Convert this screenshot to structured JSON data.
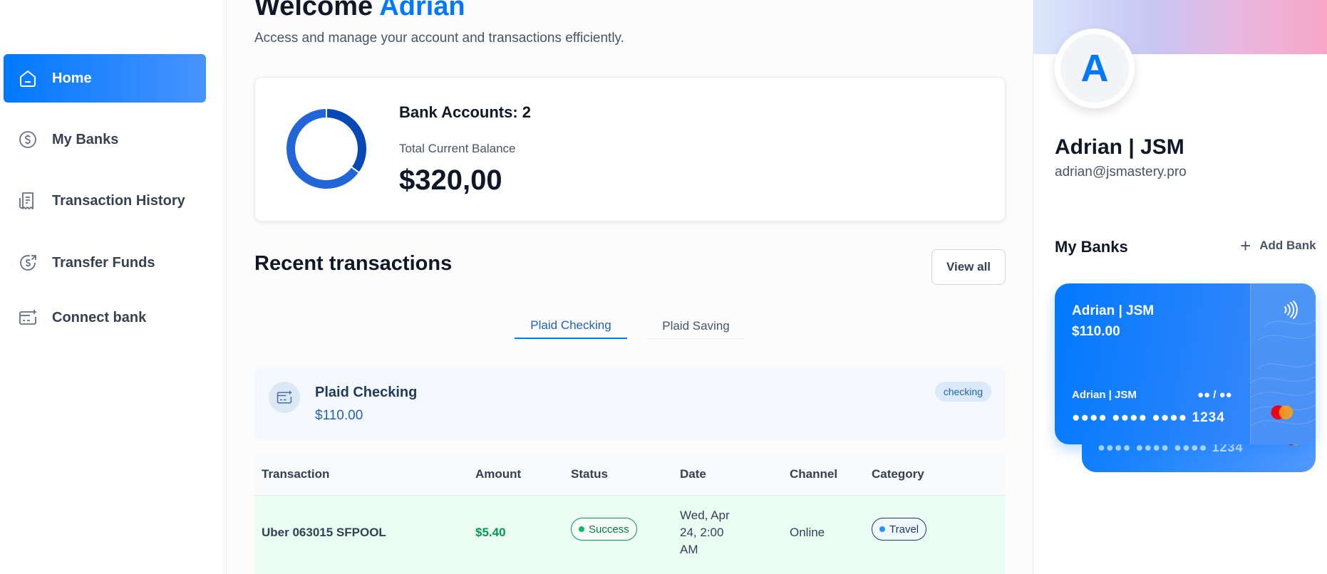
{
  "sidebar": {
    "items": [
      {
        "label": "Home",
        "icon": "home-icon",
        "active": true
      },
      {
        "label": "My Banks",
        "icon": "dollar-circle-icon",
        "active": false
      },
      {
        "label": "Transaction History",
        "icon": "receipt-icon",
        "active": false
      },
      {
        "label": "Transfer Funds",
        "icon": "money-send-icon",
        "active": false
      },
      {
        "label": "Connect bank",
        "icon": "card-add-icon",
        "active": false
      }
    ]
  },
  "header": {
    "welcome_prefix": "Welcome",
    "user_name": "Adrian",
    "subtitle": "Access and manage your account and transactions efficiently."
  },
  "balance": {
    "bank_accounts_label": "Bank Accounts: 2",
    "total_label": "Total Current Balance",
    "total_value": "$320,00",
    "donut_shares": [
      0.35,
      0.65
    ],
    "colors": [
      "#0747b6",
      "#2265d8"
    ]
  },
  "recent": {
    "title": "Recent transactions",
    "view_all": "View all",
    "tabs": [
      "Plaid Checking",
      "Plaid Saving"
    ],
    "active_tab": 0,
    "bank_info": {
      "name": "Plaid Checking",
      "amount": "$110.00",
      "type": "checking"
    },
    "columns": [
      "Transaction",
      "Amount",
      "Status",
      "Date",
      "Channel",
      "Category"
    ],
    "rows": [
      {
        "name": "Uber 063015 SFPOOL",
        "amount": "$5.40",
        "status": "Success",
        "date": "Wed, Apr 24, 2:00 AM",
        "channel": "Online",
        "category": "Travel"
      }
    ]
  },
  "profile": {
    "initial": "A",
    "name": "Adrian | JSM",
    "email": "adrian@jsmastery.pro"
  },
  "my_banks": {
    "title": "My Banks",
    "add_label": "Add Bank",
    "card": {
      "bank_name": "Adrian | JSM",
      "balance": "$110.00",
      "holder": "Adrian | JSM",
      "expiry": "●● / ●●",
      "number": "●●●● ●●●● ●●●● 1234"
    },
    "back_card": {
      "number": "●●●● ●●●● ●●●● 1234"
    }
  },
  "colors": {
    "accent": "#0179fe",
    "success": "#039855",
    "text": "#101828"
  }
}
